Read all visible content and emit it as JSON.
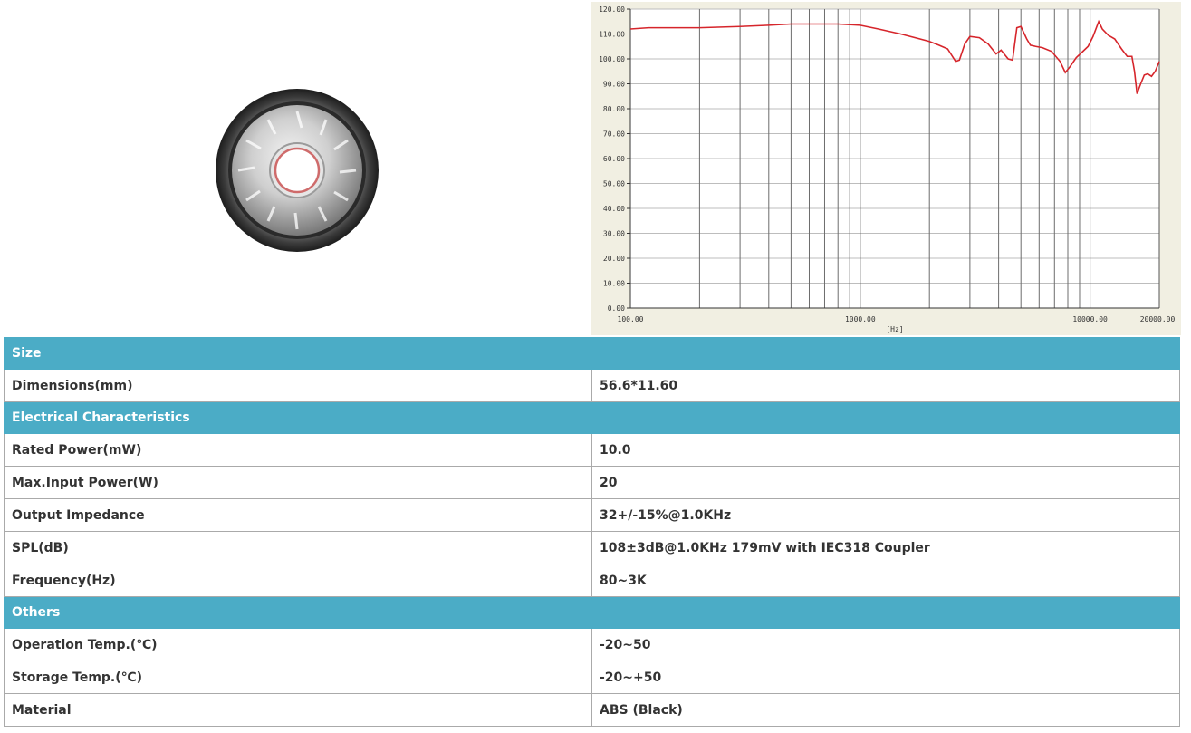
{
  "colors": {
    "section_header_bg": "#4bacc6",
    "section_header_text": "#ffffff",
    "curve": "#d6252b",
    "chart_bg": "#f1efe2",
    "plot_bg": "#ffffff"
  },
  "chart_data": {
    "type": "line",
    "x_scale": "log",
    "xlim": [
      100,
      20000
    ],
    "ylim": [
      0,
      120
    ],
    "xlabel": "[Hz]",
    "ylabel": "",
    "title": "",
    "grid": true,
    "x_ticks": [
      "100.00",
      "1000.00",
      "10000.00",
      "20000.00"
    ],
    "y_ticks": [
      "120.00",
      "110.00",
      "100.00",
      "90.00",
      "80.00",
      "70.00",
      "60.00",
      "50.00",
      "40.00",
      "30.00",
      "20.00",
      "10.00",
      "0.00"
    ],
    "series": [
      {
        "x": [
          100,
          120,
          150,
          200,
          300,
          400,
          500,
          600,
          800,
          1000,
          1200,
          1500,
          2000,
          2200,
          2400,
          2600,
          2700,
          2850,
          3000,
          3300,
          3600,
          3900,
          4100,
          4400,
          4600,
          4800,
          5000,
          5300,
          5500,
          5800,
          6200,
          6800,
          7400,
          7800,
          8200,
          8700,
          9300,
          9800,
          10300,
          10900,
          11300,
          12000,
          12800,
          13700,
          14500,
          15200,
          15600,
          16000,
          16600,
          17200,
          17800,
          18500,
          19200,
          20000
        ],
        "y": [
          112,
          112.5,
          112.5,
          112.5,
          113,
          113.5,
          114,
          114,
          114,
          113.5,
          112,
          110,
          107,
          105.5,
          104,
          99,
          99.5,
          106,
          109,
          108.5,
          106,
          102,
          103.5,
          100,
          99.5,
          112.5,
          113,
          108,
          105.5,
          105,
          104.5,
          103,
          99,
          94.5,
          97,
          100.5,
          103,
          105,
          109,
          115,
          112,
          109.5,
          108,
          104,
          101,
          101,
          95,
          86,
          90,
          93.5,
          94,
          93,
          95,
          99
        ]
      }
    ]
  },
  "specs": {
    "size": {
      "header": "Size",
      "rows": [
        {
          "label": "Dimensions(mm)",
          "value": "56.6*11.60"
        }
      ]
    },
    "electrical": {
      "header": "Electrical Characteristics",
      "rows": [
        {
          "label": "Rated Power(mW)",
          "value": "10.0"
        },
        {
          "label": "Max.Input Power(W)",
          "value": "20"
        },
        {
          "label": "Output Impedance",
          "value": "32+/-15%@1.0KHz"
        },
        {
          "label": "SPL(dB)",
          "value": "108±3dB@1.0KHz 179mV with IEC318 Coupler"
        },
        {
          "label": "Frequency(Hz)",
          "value": "80~3K"
        }
      ]
    },
    "others": {
      "header": "Others",
      "rows": [
        {
          "label": "Operation Temp.(℃)",
          "value": "-20~50"
        },
        {
          "label": "Storage Temp.(℃)",
          "value": "-20~+50"
        },
        {
          "label": "Material",
          "value": "ABS (Black)"
        }
      ]
    }
  }
}
